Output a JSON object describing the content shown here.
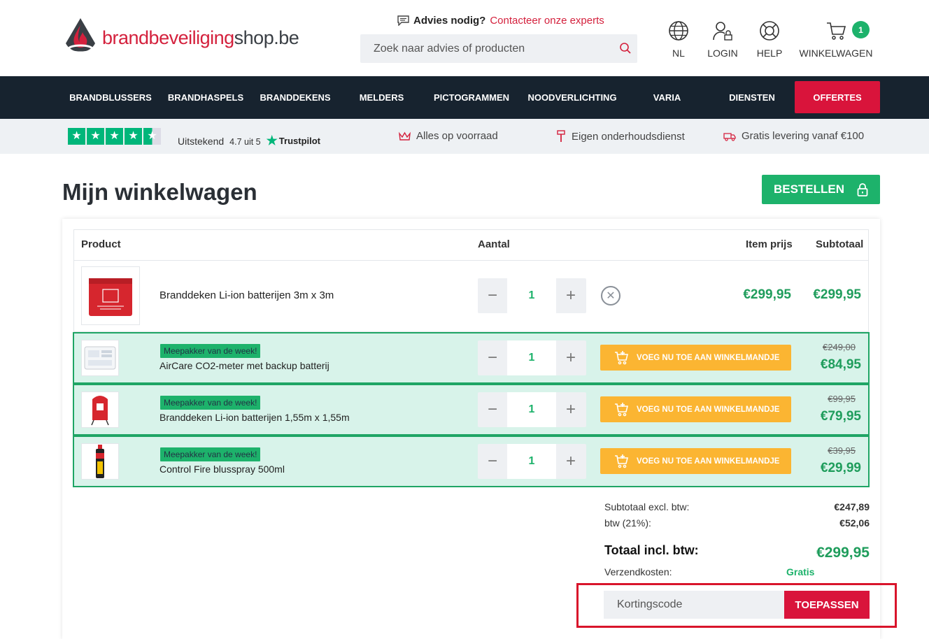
{
  "header": {
    "logo": {
      "part1": "brandbeveiliging",
      "part2": "shop.be"
    },
    "advies": {
      "bold": "Advies nodig?",
      "link": "Contacteer onze experts"
    },
    "search_placeholder": "Zoek naar advies of producten",
    "language_label": "NL",
    "login_label": "LOGIN",
    "help_label": "HELP",
    "cart_label": "WINKELWAGEN",
    "cart_count": "1"
  },
  "nav": {
    "items": [
      "BRANDBLUSSERS",
      "BRANDHASPELS",
      "BRANDDEKENS",
      "MELDERS",
      "PICTOGRAMMEN",
      "NOODVERLICHTING",
      "VARIA",
      "DIENSTEN"
    ],
    "cta": "OFFERTES"
  },
  "trust": {
    "rating_word": "Uitstekend",
    "score": "4.7 uit 5",
    "brand": "Trustpilot",
    "stars": 4.5,
    "usps": [
      "Alles op voorraad",
      "Eigen onderhoudsdienst",
      "Gratis levering vanaf €100"
    ]
  },
  "page": {
    "title": "Mijn winkelwagen",
    "order_button": "BESTELLEN"
  },
  "cart": {
    "headers": {
      "product": "Product",
      "qty": "Aantal",
      "item_price": "Item prijs",
      "subtotal": "Subtotaal"
    },
    "item": {
      "name": "Branddeken Li-ion batterijen 3m x 3m",
      "qty": "1",
      "price": "€299,95",
      "subtotal": "€299,95"
    },
    "upsell_tag": "Meepakker van de week!",
    "upsell_button": "VOEG NU TOE AAN WINKELMANDJE",
    "upsells": [
      {
        "name": "AirCare CO2-meter met backup batterij",
        "qty": "1",
        "old_price": "€249,00",
        "price": "€84,95"
      },
      {
        "name": "Branddeken Li-ion batterijen 1,55m x 1,55m",
        "qty": "1",
        "old_price": "€99,95",
        "price": "€79,95"
      },
      {
        "name": "Control Fire blusspray 500ml",
        "qty": "1",
        "old_price": "€39,95",
        "price": "€29,99"
      }
    ]
  },
  "summary": {
    "subtotal_label": "Subtotaal excl. btw:",
    "subtotal_value": "€247,89",
    "vat_label": "btw (21%):",
    "vat_value": "€52,06",
    "total_label": "Totaal incl. btw:",
    "total_value": "€299,95",
    "shipping_label": "Verzendkosten:",
    "shipping_value": "Gratis"
  },
  "coupon": {
    "placeholder": "Kortingscode",
    "button": "TOEPASSEN"
  },
  "colors": {
    "brand_red": "#d9143b",
    "green": "#1db26b",
    "navy": "#17232f",
    "orange": "#fbb532"
  }
}
